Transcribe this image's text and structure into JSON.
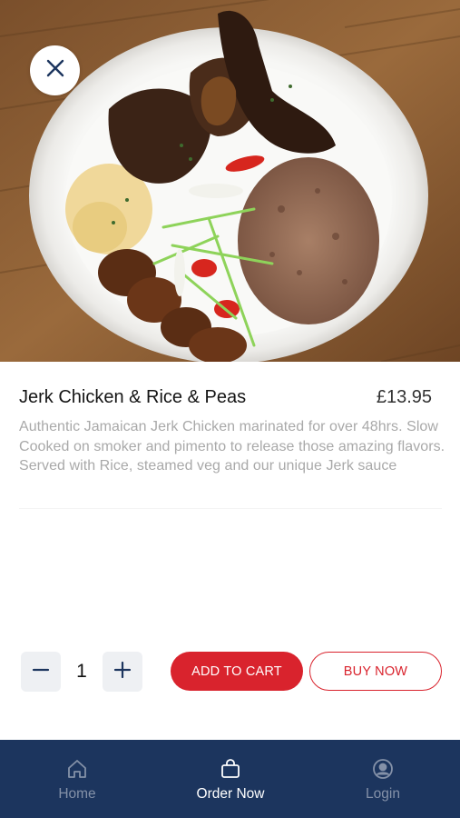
{
  "product": {
    "name": "Jerk Chicken & Rice & Peas",
    "price": "£13.95",
    "description": "Authentic Jamaican Jerk Chicken marinated for over 48hrs. Slow Cooked on smoker and pimento to release those amazing flavors. Served with Rice, steamed veg and our unique Jerk sauce",
    "image_icon": "food-photo"
  },
  "header": {
    "close_icon": "close-icon"
  },
  "quantity": {
    "value": "1",
    "minus_icon": "minus-icon",
    "plus_icon": "plus-icon"
  },
  "actions": {
    "add_to_cart_label": "ADD TO CART",
    "buy_now_label": "BUY NOW"
  },
  "tabbar": {
    "items": [
      {
        "label": "Home",
        "icon": "home-icon",
        "active": false
      },
      {
        "label": "Order Now",
        "icon": "shopping-bag-icon",
        "active": true
      },
      {
        "label": "Login",
        "icon": "user-circle-icon",
        "active": false
      }
    ]
  },
  "colors": {
    "accent": "#d9232d",
    "tabbar_bg": "#1c355e",
    "tab_inactive": "#8491a8",
    "description_text": "#a9a9a9"
  }
}
